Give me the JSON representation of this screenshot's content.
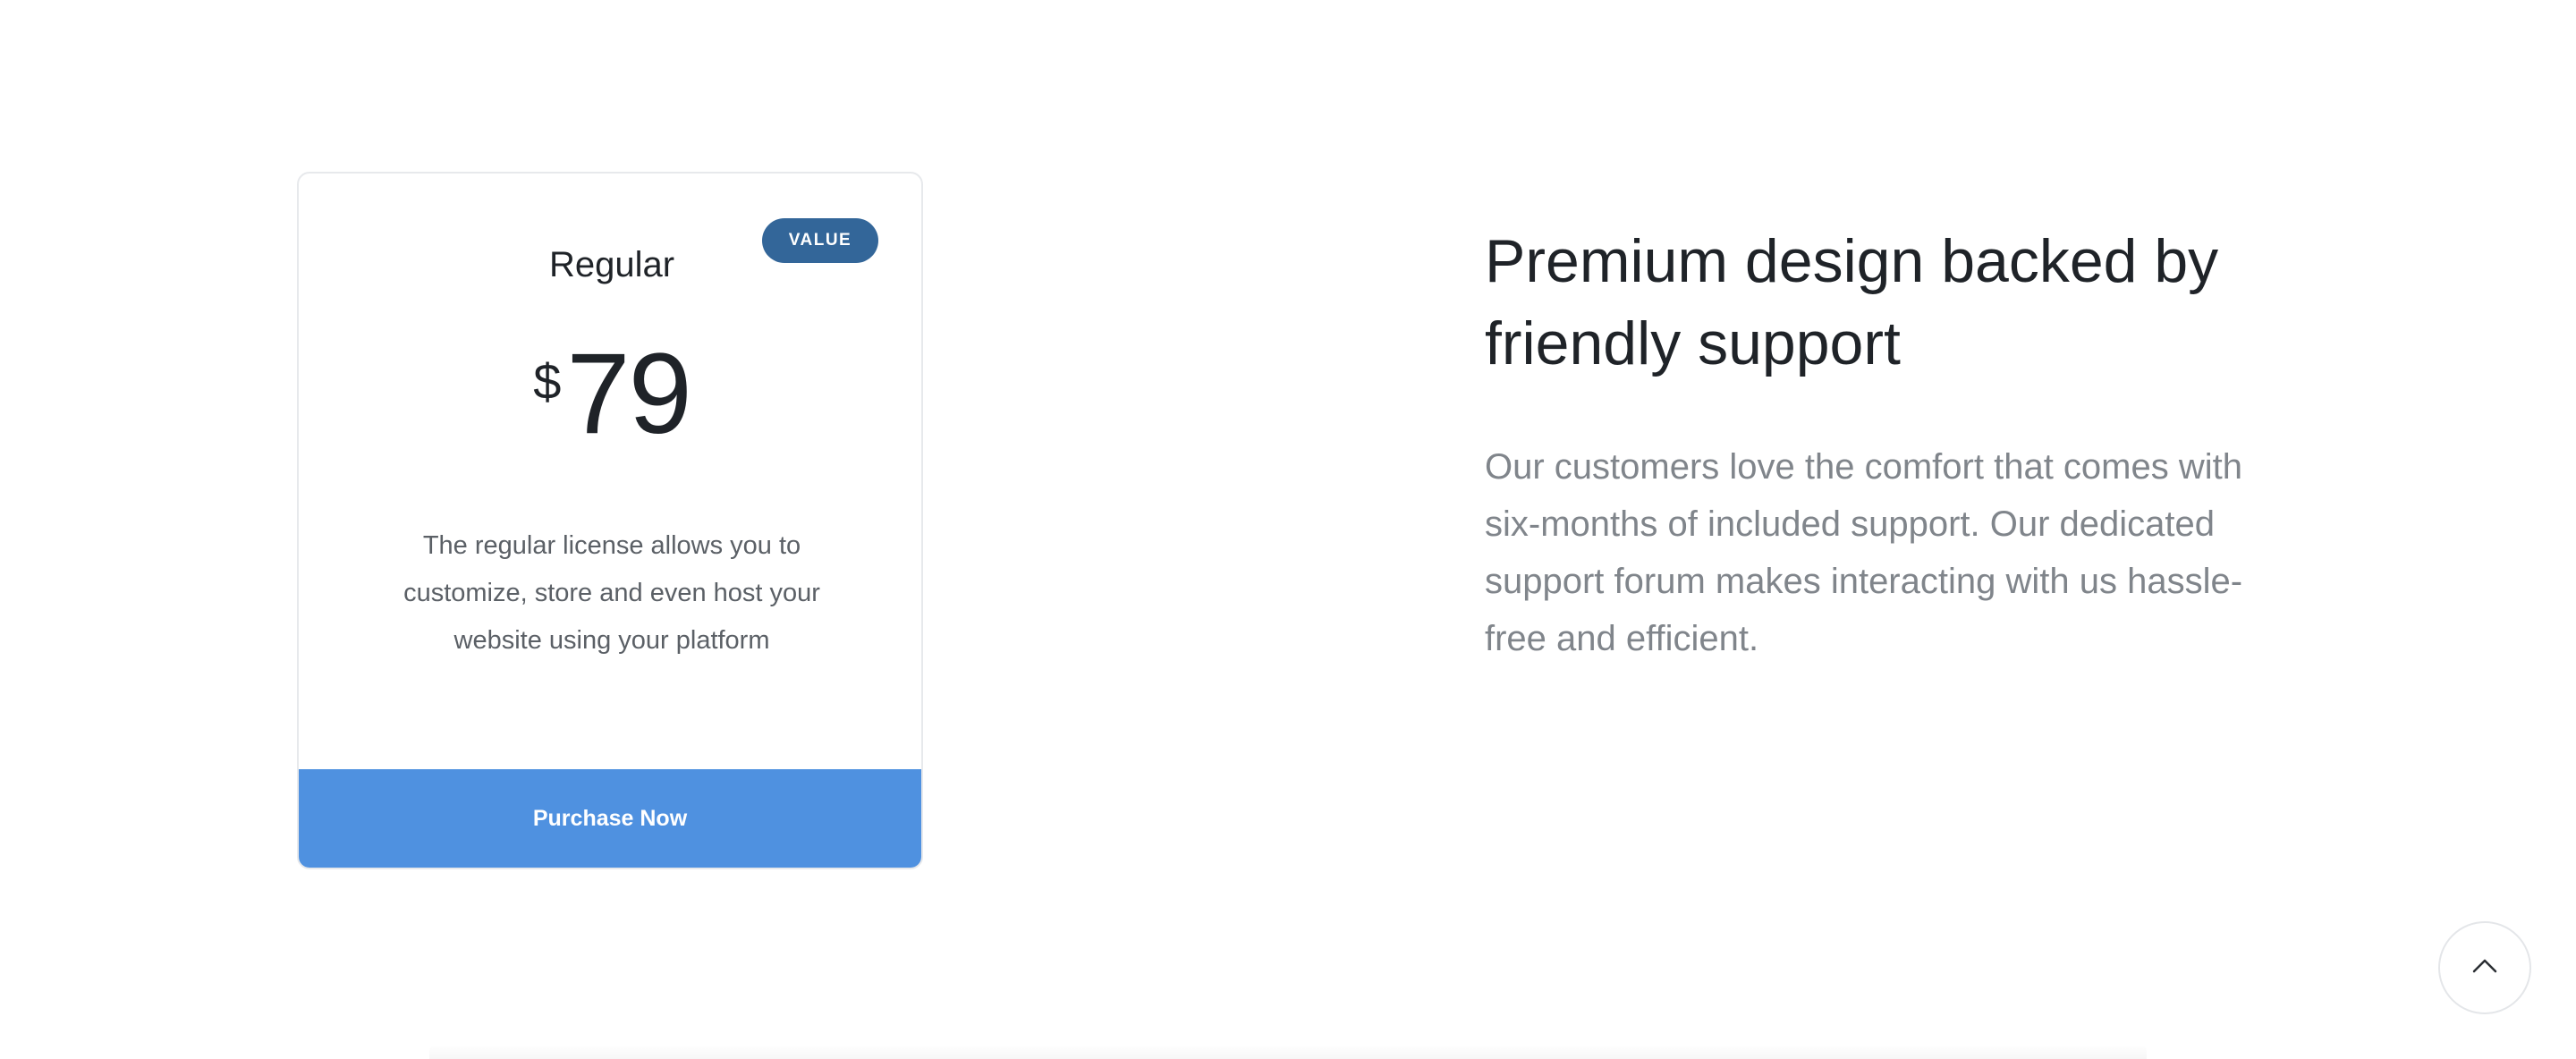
{
  "pricing_card": {
    "badge": "VALUE",
    "plan_name": "Regular",
    "price_currency": "$",
    "price_amount": "79",
    "description": "The regular license allows you to customize, store and even host your website using your platform",
    "button_label": "Purchase Now"
  },
  "feature": {
    "heading": "Premium design backed by friendly support",
    "text": "Our customers love the comfort that comes with six-months of included support. Our dedicated support forum makes interacting with us hassle-free and efficient."
  },
  "scroll_top": {
    "icon": "chevron-up-icon"
  },
  "colors": {
    "badge": "#336699",
    "button": "#4f91e0",
    "heading": "#1f2328",
    "muted_text": "#80858b"
  }
}
